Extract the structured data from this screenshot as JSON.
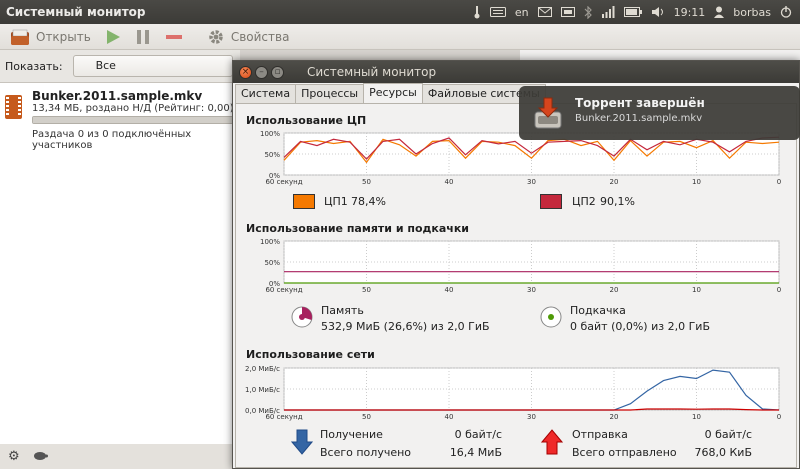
{
  "panel": {
    "app_title": "Системный монитор",
    "kbd_layout": "en",
    "time": "19:11",
    "user": "borbas"
  },
  "torrent_app": {
    "toolbar": {
      "open_label": "Открыть",
      "properties_label": "Свойства"
    },
    "filter": {
      "label": "Показать:",
      "value": "Все"
    },
    "torrent": {
      "name": "Bunker.2011.sample.mkv",
      "info": "13,34 МБ, роздано Н/Д (Рейтинг: 0,00)",
      "status": "Раздача 0 из 0 подключённых участников",
      "progress": 1.0
    }
  },
  "sysmon": {
    "title": "Системный монитор",
    "tabs": [
      "Система",
      "Процессы",
      "Ресурсы",
      "Файловые системы"
    ],
    "active_tab": "Ресурсы",
    "cpu": {
      "title": "Использование ЦП",
      "cpu1_label": "ЦП1",
      "cpu1_value": "78,4%",
      "cpu2_label": "ЦП2",
      "cpu2_value": "90,1%",
      "cpu1_color": "#f57900",
      "cpu2_color": "#c4283c"
    },
    "memory": {
      "title": "Использование памяти и подкачки",
      "mem_label": "Память",
      "mem_value": "532,9 МиБ (26,6%) из 2,0 ГиБ",
      "swap_label": "Подкачка",
      "swap_value": "0 байт (0,0%) из 2,0 ГиБ",
      "mem_color": "#a8205e",
      "swap_color": "#4e9a06"
    },
    "network": {
      "title": "Использование сети",
      "recv_label": "Получение",
      "recv_rate": "0 байт/с",
      "recv_total_label": "Всего получено",
      "recv_total": "16,4 МиБ",
      "send_label": "Отправка",
      "send_rate": "0 байт/с",
      "send_total_label": "Всего отправлено",
      "send_total": "768,0 КиБ",
      "recv_color": "#3465a4",
      "send_color": "#cc0000"
    }
  },
  "notification": {
    "title": "Торрент завершён",
    "body": "Bunker.2011.sample.mkv"
  },
  "chart_data": [
    {
      "type": "line",
      "id": "cpu",
      "x": [
        60,
        58,
        56,
        54,
        52,
        50,
        48,
        46,
        44,
        42,
        40,
        38,
        36,
        34,
        32,
        30,
        28,
        26,
        24,
        22,
        20,
        18,
        16,
        14,
        12,
        10,
        8,
        6,
        4,
        2,
        0
      ],
      "xlabel_first": "60 секунд",
      "x_ticks": [
        "60 секунд",
        "50",
        "40",
        "30",
        "20",
        "10",
        "0"
      ],
      "y_ticks": [
        "100%",
        "50%",
        "0%"
      ],
      "ylim": [
        0,
        100
      ],
      "series": [
        {
          "name": "ЦП1",
          "values": [
            35,
            78,
            82,
            75,
            80,
            30,
            85,
            72,
            45,
            80,
            82,
            40,
            80,
            78,
            70,
            40,
            82,
            85,
            70,
            80,
            35,
            82,
            45,
            78,
            80,
            65,
            82,
            40,
            78,
            75,
            78
          ]
        },
        {
          "name": "ЦП2",
          "values": [
            42,
            80,
            70,
            85,
            78,
            38,
            80,
            85,
            50,
            75,
            88,
            48,
            82,
            74,
            80,
            52,
            78,
            80,
            82,
            70,
            45,
            85,
            60,
            80,
            72,
            85,
            78,
            55,
            80,
            88,
            90
          ]
        }
      ]
    },
    {
      "type": "line",
      "id": "memory",
      "x": [
        60,
        0
      ],
      "x_ticks": [
        "60 секунд",
        "50",
        "40",
        "30",
        "20",
        "10",
        "0"
      ],
      "y_ticks": [
        "100%",
        "50%",
        "0%"
      ],
      "ylim": [
        0,
        100
      ],
      "series": [
        {
          "name": "Память",
          "values": [
            27,
            27
          ]
        },
        {
          "name": "Подкачка",
          "values": [
            0,
            0
          ]
        }
      ]
    },
    {
      "type": "line",
      "id": "network",
      "x": [
        60,
        20,
        18,
        16,
        14,
        12,
        10,
        8,
        6,
        4,
        2,
        0
      ],
      "x_ticks": [
        "60 секунд",
        "50",
        "40",
        "30",
        "20",
        "10",
        "0"
      ],
      "y_ticks": [
        "2,0 МиБ/с",
        "1,0 МиБ/с",
        "0,0 МиБ/с"
      ],
      "ylim": [
        0,
        2.0
      ],
      "series": [
        {
          "name": "Получение",
          "values": [
            0,
            0,
            0.3,
            0.9,
            1.4,
            1.6,
            1.5,
            1.9,
            1.8,
            0.7,
            0.05,
            0
          ]
        },
        {
          "name": "Отправка",
          "values": [
            0,
            0,
            0,
            0.05,
            0.05,
            0.05,
            0.04,
            0.05,
            0.05,
            0.02,
            0,
            0
          ]
        }
      ]
    }
  ]
}
